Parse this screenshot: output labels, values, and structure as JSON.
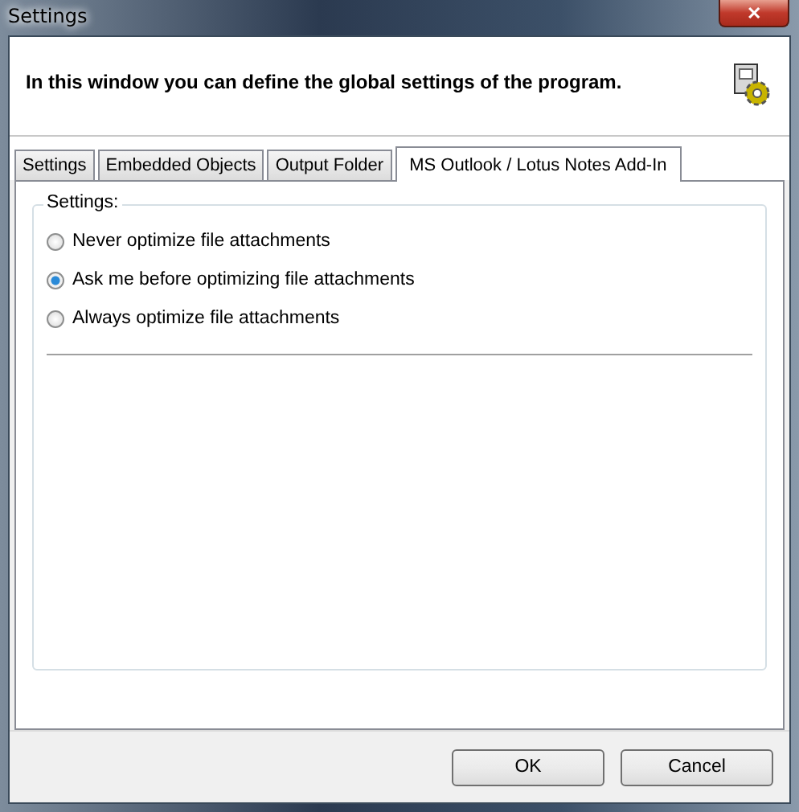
{
  "window": {
    "title": "Settings",
    "close": "✕"
  },
  "header": {
    "text": "In this window you can define the global settings of the program."
  },
  "tabs": [
    {
      "label": "Settings",
      "selected": false
    },
    {
      "label": "Embedded Objects",
      "selected": false
    },
    {
      "label": "Output Folder",
      "selected": false
    },
    {
      "label": "MS Outlook / Lotus Notes Add-In",
      "selected": true
    }
  ],
  "group": {
    "title": "Settings:"
  },
  "options": [
    {
      "label": "Never optimize file attachments",
      "selected": false
    },
    {
      "label": "Ask me before optimizing file attachments",
      "selected": true
    },
    {
      "label": "Always optimize file attachments",
      "selected": false
    }
  ],
  "buttons": [
    "OK",
    "Cancel"
  ]
}
